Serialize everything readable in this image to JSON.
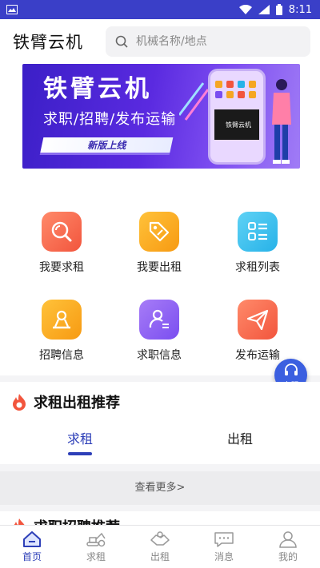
{
  "status_bar": {
    "time": "8:11"
  },
  "header": {
    "title": "铁臂云机",
    "search_placeholder": "机械名称/地点"
  },
  "banner": {
    "title": "铁臂云机",
    "subtitle": "求职/招聘/发布运输",
    "button": "新版上线",
    "phone_text": "铁臂云机"
  },
  "grid": [
    {
      "label": "我要求租",
      "color_from": "#ff8a6a",
      "color_to": "#f2553d",
      "icon": "search-icon"
    },
    {
      "label": "我要出租",
      "color_from": "#ffc23a",
      "color_to": "#f79a12",
      "icon": "price-tag-icon"
    },
    {
      "label": "求租列表",
      "color_from": "#5fd2f5",
      "color_to": "#27b2e8",
      "icon": "list-icon"
    },
    {
      "label": "招聘信息",
      "color_from": "#ffc23a",
      "color_to": "#f79a12",
      "icon": "recruit-icon"
    },
    {
      "label": "求职信息",
      "color_from": "#a77cf7",
      "color_to": "#7a4ef0",
      "icon": "resume-icon"
    },
    {
      "label": "发布运输",
      "color_from": "#ff8a6a",
      "color_to": "#f2553d",
      "icon": "send-icon"
    }
  ],
  "float_service": {
    "label": "客服"
  },
  "recommend": {
    "title": "求租出租推荐",
    "tabs": [
      {
        "label": "求租",
        "active": true
      },
      {
        "label": "出租",
        "active": false
      }
    ],
    "more": "查看更多>"
  },
  "next_section": {
    "title": "求职招聘推荐"
  },
  "bottom_nav": [
    {
      "label": "首页",
      "active": true,
      "icon": "home-icon"
    },
    {
      "label": "求租",
      "active": false,
      "icon": "excavator-icon"
    },
    {
      "label": "出租",
      "active": false,
      "icon": "handshake-icon"
    },
    {
      "label": "消息",
      "active": false,
      "icon": "message-icon"
    },
    {
      "label": "我的",
      "active": false,
      "icon": "profile-icon"
    }
  ],
  "colors": {
    "primary": "#2d3fb8",
    "status_bar": "#3a3fc8",
    "fire": "#f2553d"
  }
}
